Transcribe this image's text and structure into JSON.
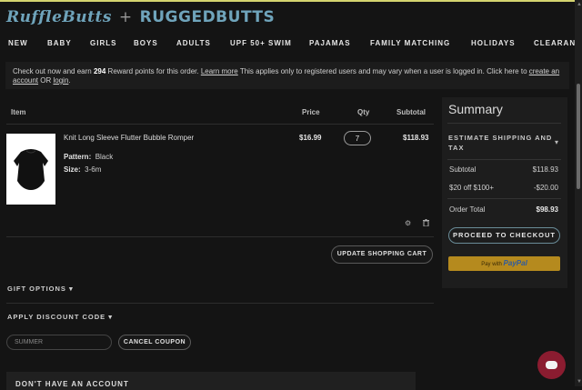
{
  "brand": {
    "left": "RuffleButts",
    "separator": "+",
    "right": "RUGGEDBUTTS"
  },
  "nav": [
    "NEW",
    "BABY",
    "GIRLS",
    "BOYS",
    "ADULTS",
    "UPF 50+ SWIM",
    "PAJAMAS",
    "FAMILY MATCHING",
    "HOLIDAYS",
    "CLEARAN"
  ],
  "notice": {
    "t1": "Check out now and earn ",
    "points": "294",
    "t2": " Reward points for this order. ",
    "learn_more": "Learn more",
    "t3": " This applies only to registered users and may vary when a user is logged in. Click here to ",
    "create_account": "create an account",
    "t4": " OR ",
    "login": "login",
    "t5": "."
  },
  "cart": {
    "headers": {
      "item": "Item",
      "price": "Price",
      "qty": "Qty",
      "subtotal": "Subtotal"
    },
    "item": {
      "name": "Knit Long Sleeve Flutter Bubble Romper",
      "pattern_label": "Pattern:",
      "pattern_value": "Black",
      "size_label": "Size:",
      "size_value": "3-6m",
      "price": "$16.99",
      "qty": "7",
      "subtotal": "$118.93"
    },
    "update_button": "UPDATE SHOPPING CART",
    "gift_options": "GIFT OPTIONS",
    "discount": "APPLY DISCOUNT CODE",
    "coupon_value": "SUMMER",
    "cancel_coupon": "CANCEL COUPON",
    "account_heading": "DON'T HAVE AN ACCOUNT"
  },
  "summary": {
    "title": "Summary",
    "estimate": "ESTIMATE SHIPPING AND TAX",
    "rows": [
      {
        "label": "Subtotal",
        "value": "$118.93"
      },
      {
        "label": "$20 off $100+",
        "value": "-$20.00"
      }
    ],
    "order_total_label": "Order Total",
    "order_total_value": "$98.93",
    "checkout_button": "PROCEED TO CHECKOUT",
    "paypal_prefix": "Pay with",
    "paypal_brand": "PayPal"
  },
  "icons": [
    "gear-icon",
    "trash-icon",
    "chevron-down-icon",
    "chat-icon"
  ],
  "colors": {
    "accent": "#6fa4bb",
    "background": "#141414",
    "chat": "#8b1c30",
    "paypal": "#b58a1e"
  }
}
